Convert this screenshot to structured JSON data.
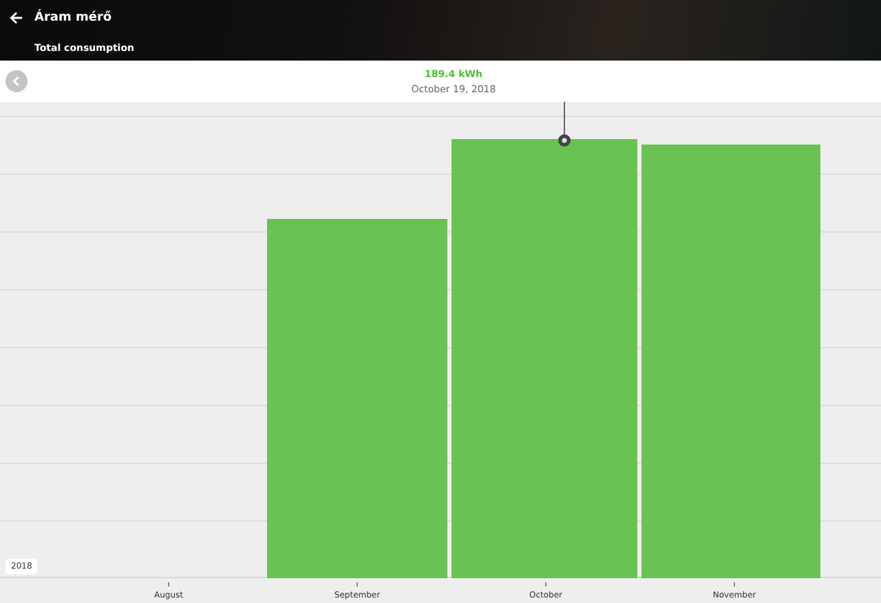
{
  "header": {
    "title": "Áram mérő",
    "subtitle": "Total consumption"
  },
  "tooltip": {
    "value": "189.4 kWh",
    "date": "October 19, 2018"
  },
  "chart": {
    "year": "2018",
    "months": [
      "August",
      "September",
      "October",
      "November"
    ]
  }
}
